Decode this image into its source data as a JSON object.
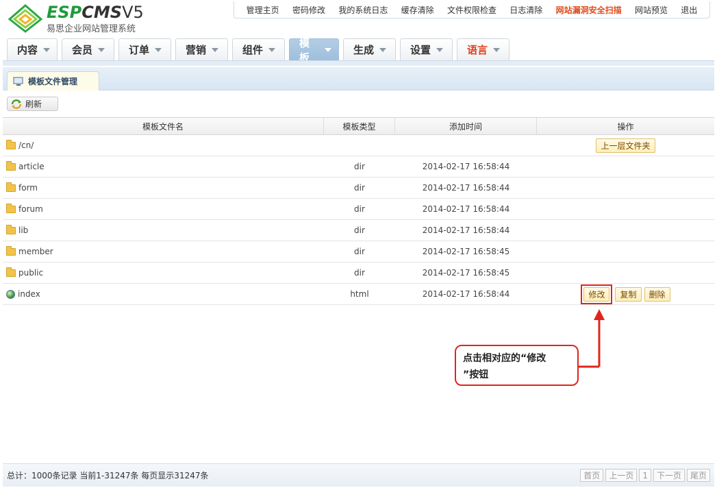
{
  "brand": {
    "logo_esp": "ESP",
    "logo_cms": "CMS",
    "logo_ver": "V5",
    "subtitle": "易思企业网站管理系统",
    "accent_green": "#1e9b3b"
  },
  "topnav": [
    "管理主页",
    "密码修改",
    "我的系统日志",
    "缓存清除",
    "文件权限检查",
    "日志清除",
    "网站漏洞安全扫描",
    "网站预览",
    "退出"
  ],
  "menu": [
    {
      "label": "内容"
    },
    {
      "label": "会员"
    },
    {
      "label": "订单"
    },
    {
      "label": "营销"
    },
    {
      "label": "组件"
    },
    {
      "label": "模板",
      "active": true
    },
    {
      "label": "生成"
    },
    {
      "label": "设置"
    },
    {
      "label": "语言",
      "red": true
    }
  ],
  "subtab": {
    "label": "模板文件管理",
    "icon": "monitor-icon"
  },
  "toolbar": {
    "refresh_label": "刷新",
    "icon": "refresh-icon"
  },
  "table": {
    "headers": [
      "模板文件名",
      "模板类型",
      "添加时间",
      "操作"
    ],
    "parent_row": {
      "name": "/cn/",
      "action": "上一层文件夹"
    },
    "rows": [
      {
        "name": "article",
        "type": "dir",
        "time": "2014-02-17 16:58:44",
        "icon": "folder-icon"
      },
      {
        "name": "form",
        "type": "dir",
        "time": "2014-02-17 16:58:44",
        "icon": "folder-icon"
      },
      {
        "name": "forum",
        "type": "dir",
        "time": "2014-02-17 16:58:44",
        "icon": "folder-icon"
      },
      {
        "name": "lib",
        "type": "dir",
        "time": "2014-02-17 16:58:44",
        "icon": "folder-icon"
      },
      {
        "name": "member",
        "type": "dir",
        "time": "2014-02-17 16:58:45",
        "icon": "folder-icon"
      },
      {
        "name": "public",
        "type": "dir",
        "time": "2014-02-17 16:58:45",
        "icon": "folder-icon"
      }
    ],
    "file_row": {
      "name": "index",
      "type": "html",
      "time": "2014-02-17 16:58:44",
      "icon": "globe-icon",
      "actions": {
        "edit": "修改",
        "copy": "复制",
        "delete": "删除"
      }
    }
  },
  "annotation": {
    "line1": "点击相对应的“修改",
    "line2": "”按钮",
    "color": "#e0241b"
  },
  "footer": {
    "stat": "总计：1000条记录 当前1-31247条 每页显示31247条",
    "pager": [
      "首页",
      "上一页",
      "1",
      "下一页",
      "尾页"
    ]
  }
}
